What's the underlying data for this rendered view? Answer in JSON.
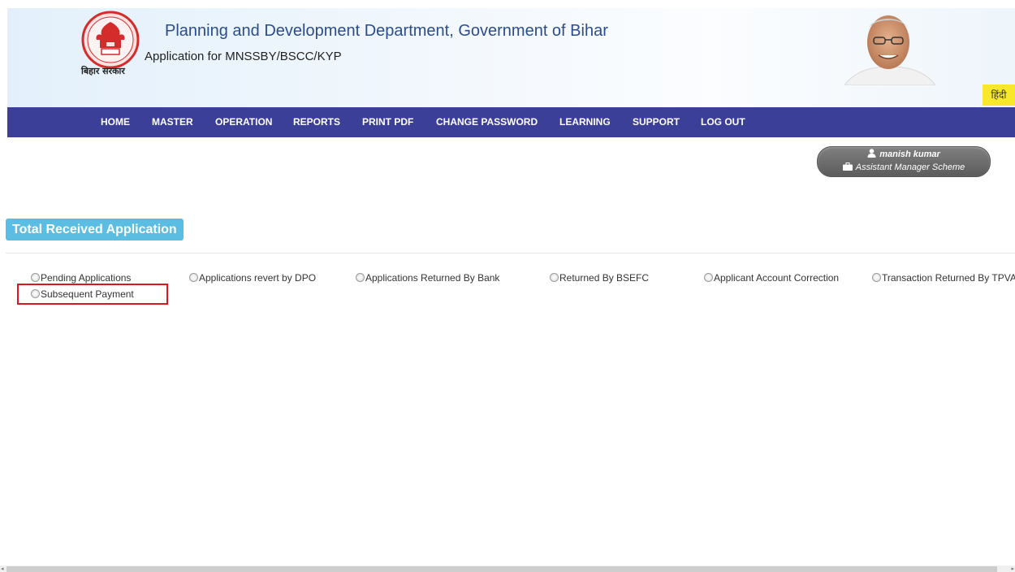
{
  "header": {
    "emblem_caption": "बिहार सरकार",
    "department_title": "Planning and Development Department, Government of Bihar",
    "app_subtitle": "Application for MNSSBY/BSCC/KYP",
    "language_button": "हिंदी"
  },
  "nav": {
    "items": [
      "HOME",
      "MASTER",
      "OPERATION",
      "REPORTS",
      "PRINT PDF",
      "CHANGE PASSWORD",
      "LEARNING",
      "SUPPORT",
      "LOG OUT"
    ]
  },
  "user": {
    "name": "manish kumar",
    "role": "Assistant Manager Scheme"
  },
  "section": {
    "title": "Total Received Application"
  },
  "options": [
    "Pending Applications",
    "Applications revert by DPO",
    "Applications Returned By Bank",
    "Returned By BSEFC",
    "Applicant Account Correction",
    "Transaction Returned By TPVA",
    "Subsequent Payment"
  ]
}
